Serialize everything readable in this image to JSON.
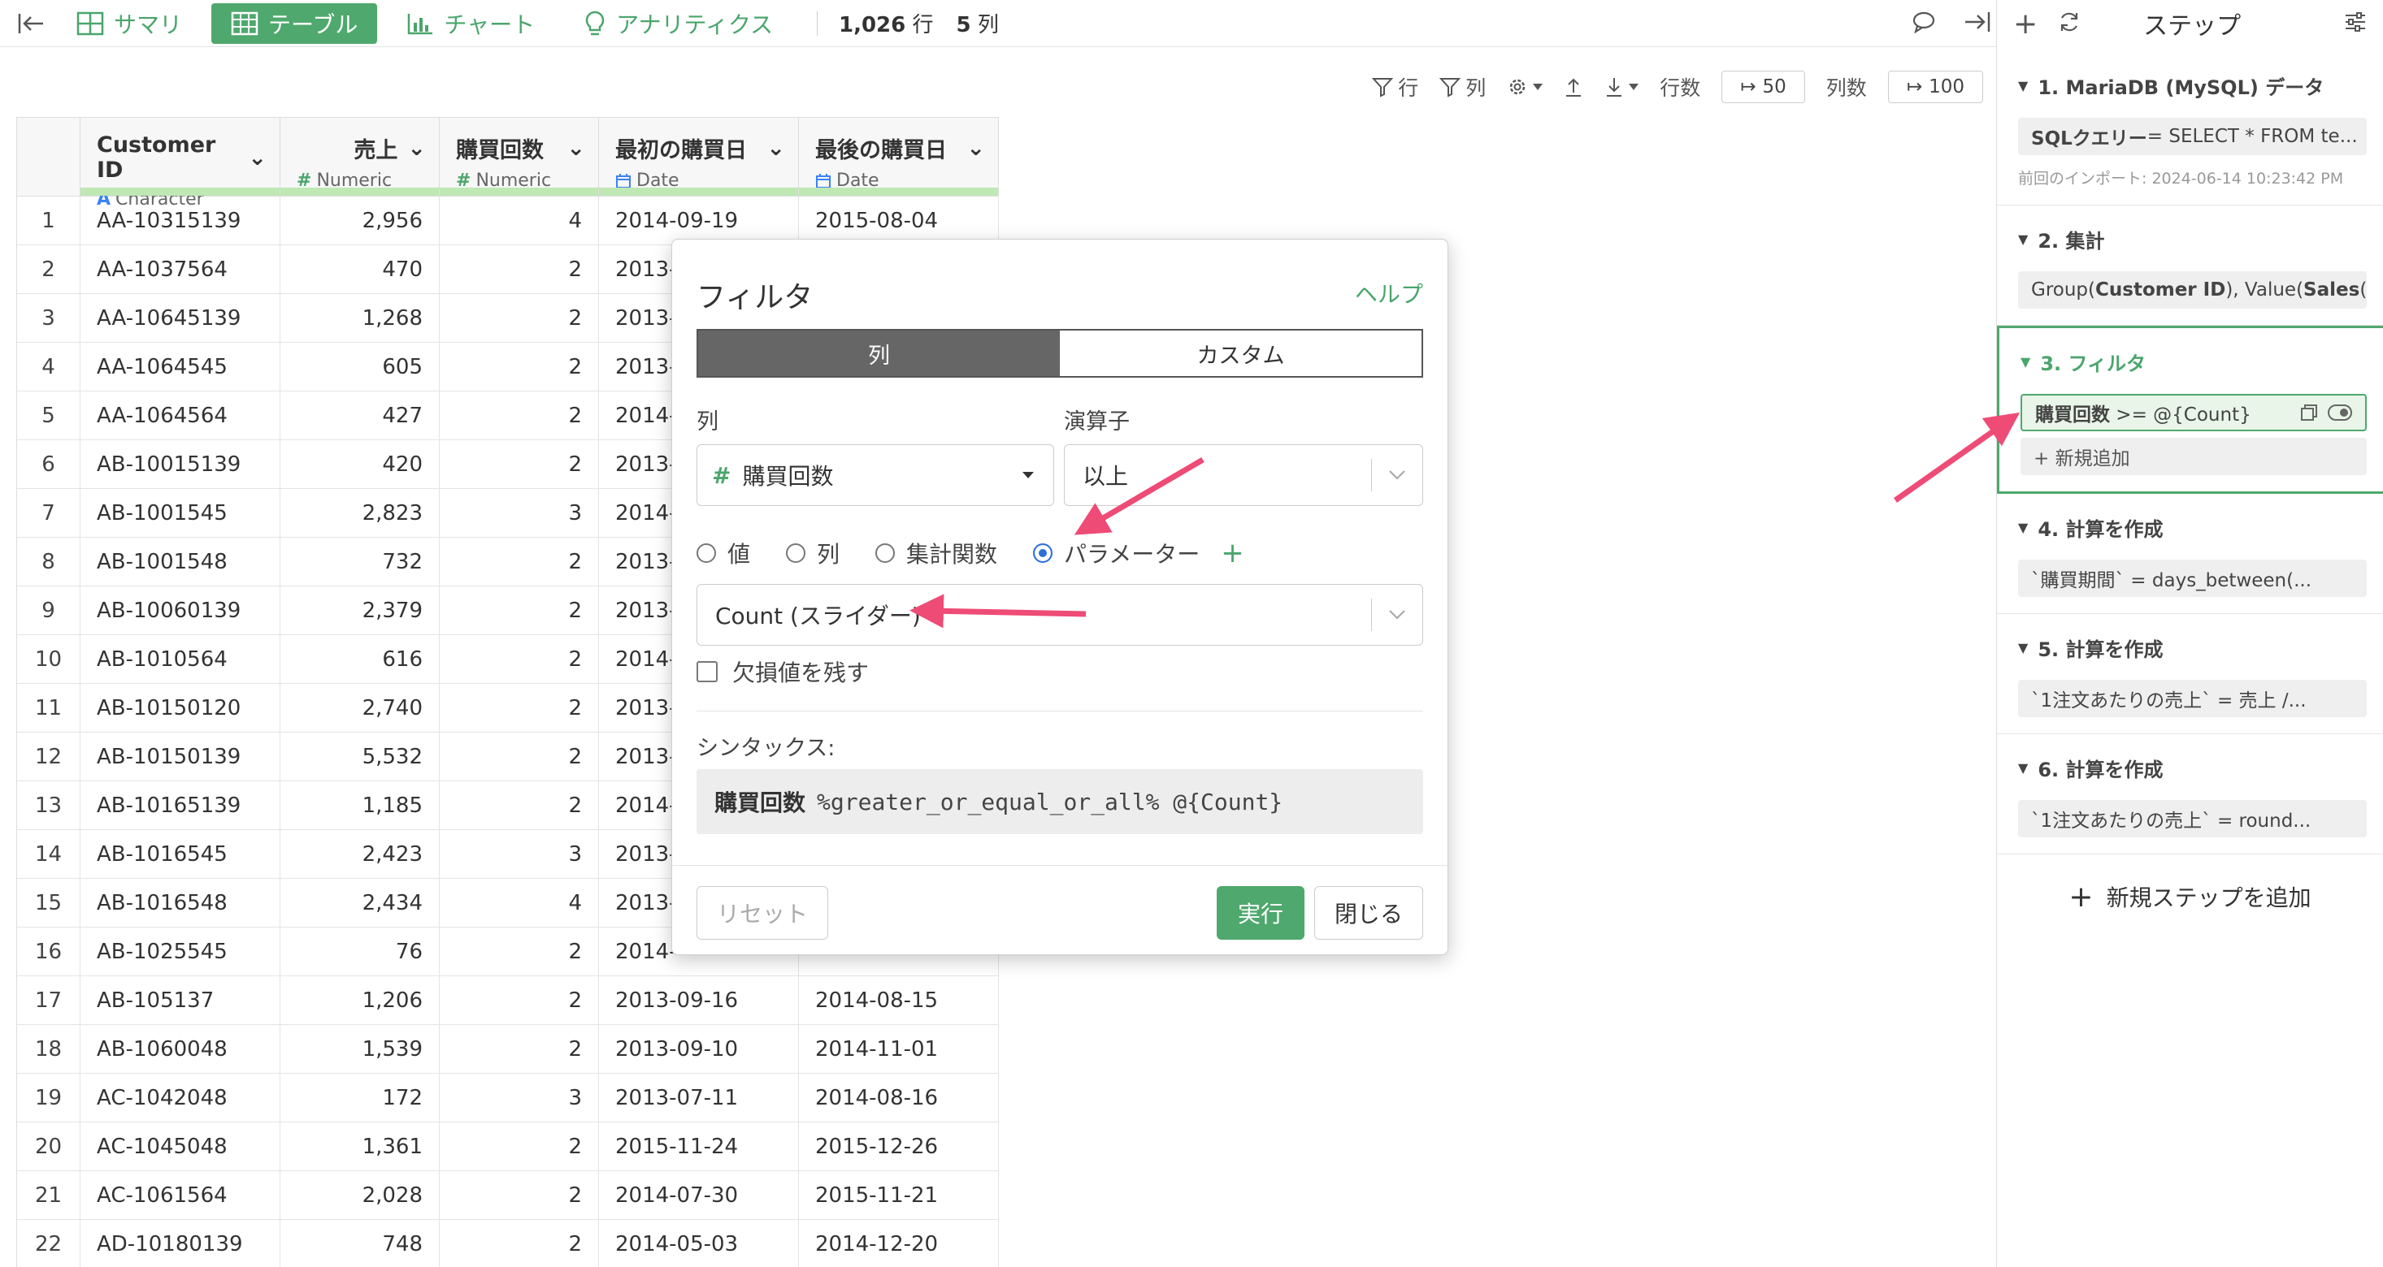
{
  "toolbar": {
    "tabs": [
      {
        "label": "サマリ",
        "icon": "summary-icon"
      },
      {
        "label": "テーブル",
        "icon": "table-icon",
        "active": true
      },
      {
        "label": "チャート",
        "icon": "chart-icon"
      },
      {
        "label": "アナリティクス",
        "icon": "analytics-icon"
      }
    ],
    "row_count": "1,026",
    "row_unit": "行",
    "col_count": "5",
    "col_unit": "列"
  },
  "subbar": {
    "row_filter": "行",
    "col_filter": "列",
    "rows_label": "行数",
    "rows_value": "50",
    "cols_label": "列数",
    "cols_value": "100"
  },
  "grid": {
    "columns": [
      {
        "name": "Customer ID",
        "type": "Character",
        "type_icon": "A"
      },
      {
        "name": "売上",
        "type": "Numeric",
        "type_icon": "#"
      },
      {
        "name": "購買回数",
        "type": "Numeric",
        "type_icon": "#"
      },
      {
        "name": "最初の購買日",
        "type": "Date",
        "type_icon": "calendar-icon"
      },
      {
        "name": "最後の購買日",
        "type": "Date",
        "type_icon": "calendar-icon"
      }
    ],
    "rows": [
      [
        "1",
        "AA-10315139",
        "2,956",
        "4",
        "2014-09-19",
        "2015-08-04"
      ],
      [
        "2",
        "AA-1037564",
        "470",
        "2",
        "2013-",
        ""
      ],
      [
        "3",
        "AA-10645139",
        "1,268",
        "2",
        "2013-",
        ""
      ],
      [
        "4",
        "AA-1064545",
        "605",
        "2",
        "2013-",
        ""
      ],
      [
        "5",
        "AA-1064564",
        "427",
        "2",
        "2014-",
        ""
      ],
      [
        "6",
        "AB-10015139",
        "420",
        "2",
        "2013-",
        ""
      ],
      [
        "7",
        "AB-1001545",
        "2,823",
        "3",
        "2014-",
        ""
      ],
      [
        "8",
        "AB-1001548",
        "732",
        "2",
        "2013-",
        ""
      ],
      [
        "9",
        "AB-10060139",
        "2,379",
        "2",
        "2013-",
        ""
      ],
      [
        "10",
        "AB-1010564",
        "616",
        "2",
        "2014-",
        ""
      ],
      [
        "11",
        "AB-10150120",
        "2,740",
        "2",
        "2013-",
        ""
      ],
      [
        "12",
        "AB-10150139",
        "5,532",
        "2",
        "2013-",
        ""
      ],
      [
        "13",
        "AB-10165139",
        "1,185",
        "2",
        "2014-",
        ""
      ],
      [
        "14",
        "AB-1016545",
        "2,423",
        "3",
        "2013-",
        ""
      ],
      [
        "15",
        "AB-1016548",
        "2,434",
        "4",
        "2013-",
        ""
      ],
      [
        "16",
        "AB-1025545",
        "76",
        "2",
        "2014-",
        ""
      ],
      [
        "17",
        "AB-105137",
        "1,206",
        "2",
        "2013-09-16",
        "2014-08-15"
      ],
      [
        "18",
        "AB-1060048",
        "1,539",
        "2",
        "2013-09-10",
        "2014-11-01"
      ],
      [
        "19",
        "AC-1042048",
        "172",
        "3",
        "2013-07-11",
        "2014-08-16"
      ],
      [
        "20",
        "AC-1045048",
        "1,361",
        "2",
        "2015-11-24",
        "2015-12-26"
      ],
      [
        "21",
        "AC-1061564",
        "2,028",
        "2",
        "2014-07-30",
        "2015-11-21"
      ],
      [
        "22",
        "AD-10180139",
        "748",
        "2",
        "2014-05-03",
        "2014-12-20"
      ]
    ]
  },
  "dialog": {
    "title": "フィルタ",
    "help": "ヘルプ",
    "seg_column": "列",
    "seg_custom": "カスタム",
    "column_label": "列",
    "column_value": "購買回数",
    "operator_label": "演算子",
    "operator_value": "以上",
    "radio_value": "値",
    "radio_column": "列",
    "radio_aggregate": "集計関数",
    "radio_parameter": "パラメーター",
    "parameter_value": "Count (スライダー)",
    "keep_na": "欠損値を残す",
    "syntax_label": "シンタックス:",
    "syntax_col": "購買回数",
    "syntax_expr": "%greater_or_equal_or_all% @{Count}",
    "reset": "リセット",
    "run": "実行",
    "close": "閉じる"
  },
  "steps": {
    "title": "ステップ",
    "items": [
      {
        "title": "1. MariaDB (MySQL) データ",
        "body_b": "SQLクエリー",
        "body": " = SELECT * FROM te...",
        "meta": "前回のインポート: 2024-06-14 10:23:42 PM"
      },
      {
        "title": "2. 集計",
        "body": "Group(",
        "body_b": "Customer ID",
        "body2": "), Value(",
        "body_b2": "Sales",
        "body3": " (..."
      },
      {
        "title": "3. フィルタ",
        "body_b": "購買回数",
        "body": " >= @{Count}",
        "add": "+ 新規追加"
      },
      {
        "title": "4. 計算を作成",
        "body": "`購買期間` = days_between(..."
      },
      {
        "title": "5. 計算を作成",
        "body": "`1注文あたりの売上` = 売上 /..."
      },
      {
        "title": "6. 計算を作成",
        "body": "`1注文あたりの売上` = round..."
      }
    ],
    "add_step": "新規ステップを追加"
  },
  "colors": {
    "accent": "#4fa86d",
    "arrow": "#ee4b77",
    "radio": "#2f6fd6"
  }
}
